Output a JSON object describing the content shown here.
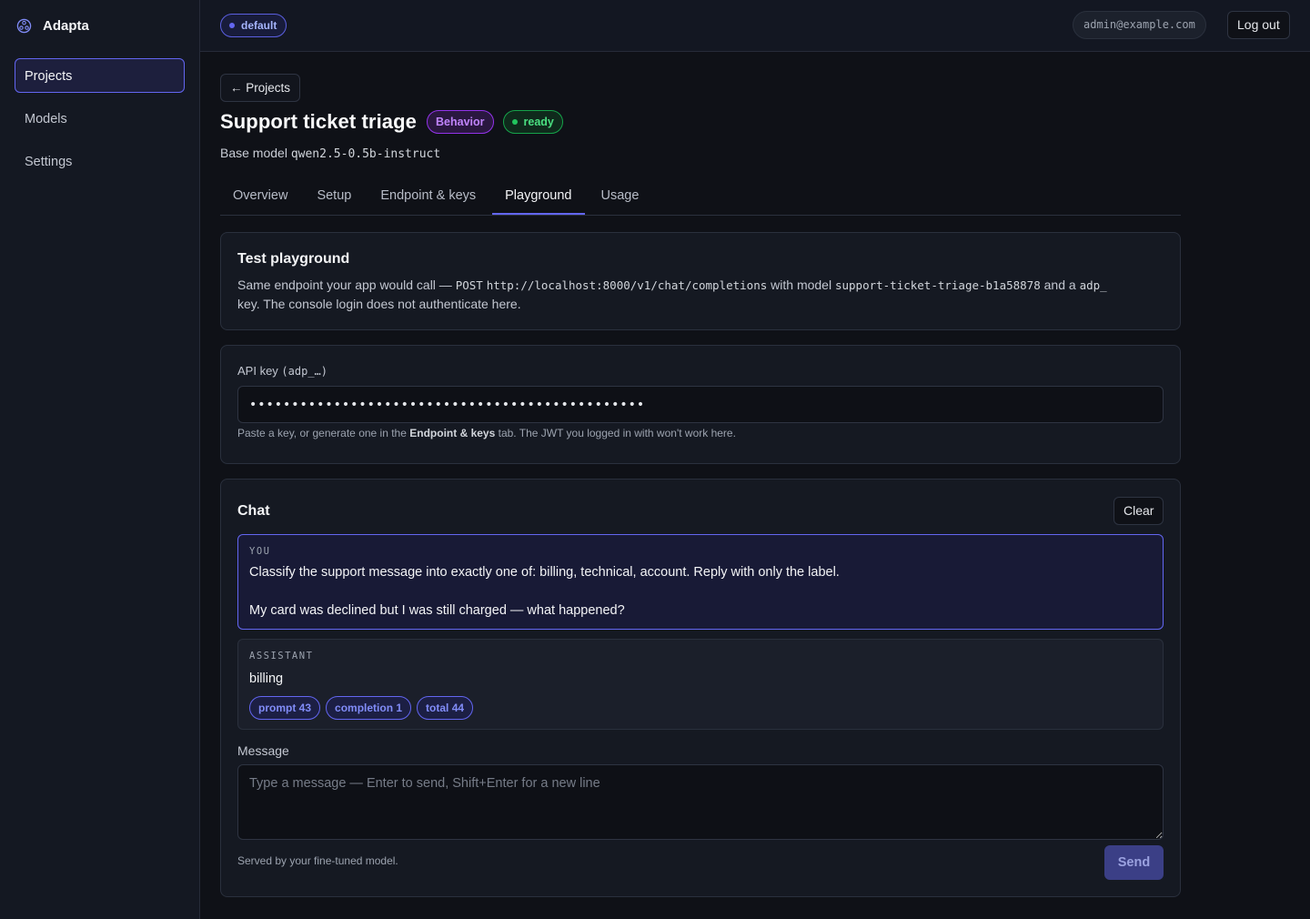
{
  "sidebar": {
    "brand": "Adapta",
    "items": [
      {
        "label": "Projects",
        "active": true
      },
      {
        "label": "Models",
        "active": false
      },
      {
        "label": "Settings",
        "active": false
      }
    ]
  },
  "header": {
    "org": "default",
    "user_email": "admin@example.com",
    "logout_label": "Log out"
  },
  "project": {
    "back_label": "← Projects",
    "title": "Support ticket triage",
    "type_badge": "Behavior",
    "status_badge": "ready",
    "base_model_prefix": "Base model",
    "base_model": "qwen2.5-0.5b-instruct"
  },
  "tabs": [
    {
      "label": "Overview",
      "active": false
    },
    {
      "label": "Setup",
      "active": false
    },
    {
      "label": "Endpoint & keys",
      "active": false
    },
    {
      "label": "Playground",
      "active": true
    },
    {
      "label": "Usage",
      "active": false
    }
  ],
  "playground": {
    "title": "Test playground",
    "desc_1": "Same endpoint your app would call —",
    "method": "POST",
    "url": "http://localhost:8000/v1/chat/completions",
    "desc_2": "with model",
    "model_id": "support-ticket-triage-b1a58878",
    "desc_3": "and a",
    "key_prefix": "adp_",
    "desc_4": "key. The console login does not authenticate here."
  },
  "api_key": {
    "label": "API key",
    "label_mono": "(adp_…)",
    "value": "•••••••••••••••••••••••••••••••••••••••••••••••",
    "hint_1": "Paste a key, or generate one in the",
    "hint_bold": "Endpoint & keys",
    "hint_2": "tab. The JWT you logged in with won't work here."
  },
  "chat": {
    "title": "Chat",
    "clear_label": "Clear",
    "user_role": "YOU",
    "user_line1": "Classify the support message into exactly one of: billing, technical, account. Reply with only the label.",
    "user_line2": "My card was declined but I was still charged — what happened?",
    "assistant_role": "ASSISTANT",
    "assistant_text": "billing",
    "tokens": {
      "prompt": "prompt 43",
      "completion": "completion 1",
      "total": "total 44"
    },
    "message_label": "Message",
    "message_placeholder": "Type a message — Enter to send, Shift+Enter for a new line",
    "served_by": "Served by your fine-tuned model.",
    "send_label": "Send"
  },
  "colors": {
    "accent": "#6366f1",
    "behavior": "#c084fc",
    "ready": "#4ade80",
    "background": "#0f1117"
  }
}
